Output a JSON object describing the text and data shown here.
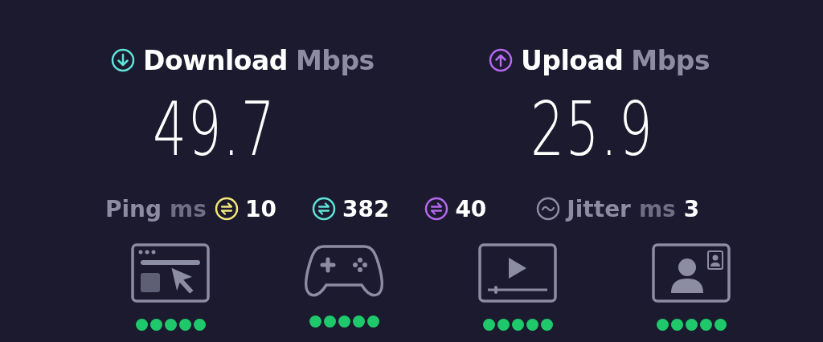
{
  "results": [
    {
      "kind": "download",
      "label": "Download",
      "unit": "Mbps",
      "value": "49.7",
      "color": "#5fe3d9"
    },
    {
      "kind": "upload",
      "label": "Upload",
      "unit": "Mbps",
      "value": "25.9",
      "color": "#b568f0"
    }
  ],
  "ping": {
    "label": "Ping",
    "unit": "ms",
    "readings": [
      {
        "value": "10",
        "color": "#f2e77a"
      },
      {
        "value": "382",
        "color": "#5fe3d9"
      },
      {
        "value": "40",
        "color": "#b568f0"
      }
    ]
  },
  "jitter": {
    "label": "Jitter",
    "unit": "ms",
    "value": "3"
  },
  "services": [
    {
      "kind": "web",
      "stars": 5
    },
    {
      "kind": "gaming",
      "stars": 5
    },
    {
      "kind": "video",
      "stars": 5
    },
    {
      "kind": "call",
      "stars": 5
    }
  ]
}
